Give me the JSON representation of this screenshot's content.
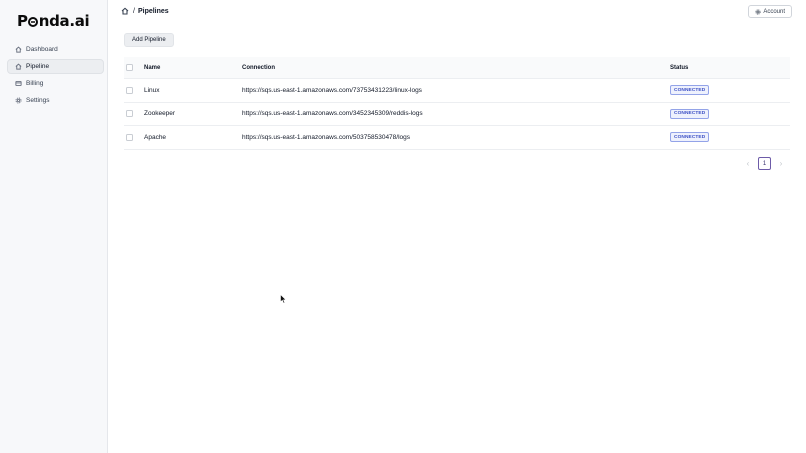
{
  "app": {
    "logo_text_left": "P",
    "logo_text_right": "nda.ai"
  },
  "sidebar": {
    "items": [
      {
        "label": "Dashboard",
        "icon": "home-icon",
        "active": false
      },
      {
        "label": "Pipeline",
        "icon": "home-icon",
        "active": true
      },
      {
        "label": "Billing",
        "icon": "credit-card-icon",
        "active": false
      },
      {
        "label": "Settings",
        "icon": "gear-icon",
        "active": false
      }
    ]
  },
  "header": {
    "breadcrumb_sep": "/",
    "title": "Pipelines",
    "account_label": "Account"
  },
  "toolbar": {
    "add_label": "Add Pipeline"
  },
  "table": {
    "columns": {
      "name": "Name",
      "connection": "Connection",
      "status": "Status"
    },
    "rows": [
      {
        "name": "Linux",
        "connection": "https://sqs.us-east-1.amazonaws.com/73753431223/linux-logs",
        "status": "CONNECTED"
      },
      {
        "name": "Zookeeper",
        "connection": "https://sqs.us-east-1.amazonaws.com/3452345309/reddis-logs",
        "status": "CONNECTED"
      },
      {
        "name": "Apache",
        "connection": "https://sqs.us-east-1.amazonaws.com/503758530478/logs",
        "status": "CONNECTED"
      }
    ]
  },
  "pagination": {
    "prev": "‹",
    "current": "1",
    "next": "›"
  },
  "colors": {
    "accent": "#6d5ba8",
    "badge_text": "#3b4fc4",
    "badge_border": "#93a3e8"
  }
}
